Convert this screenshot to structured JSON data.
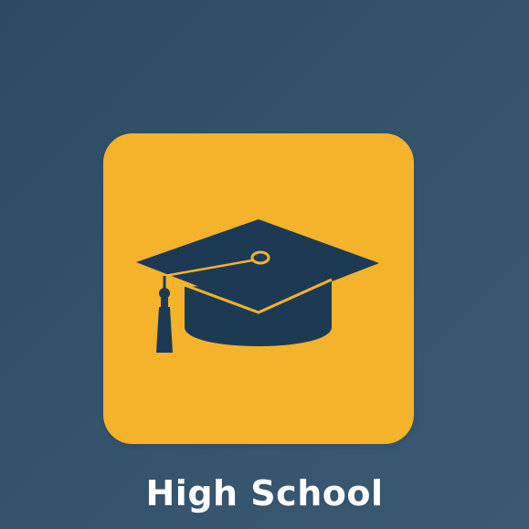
{
  "app": {
    "label": "High School",
    "icon": "graduation-cap-icon",
    "colors": {
      "background": "#33536d",
      "tile": "#f5b32b",
      "icon": "#1d3a55",
      "label": "#ffffff"
    }
  }
}
